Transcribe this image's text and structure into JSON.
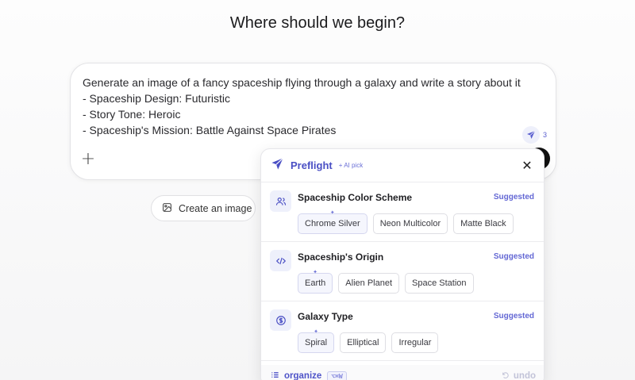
{
  "heading": "Where should we begin?",
  "composer": {
    "prompt_lines": [
      "Generate an image of a fancy spaceship flying through a galaxy and write a story about it",
      "- Spaceship Design: Futuristic",
      "- Story Tone: Heroic",
      "- Spaceship's Mission: Battle Against Space Pirates"
    ],
    "plus_glyph": "+",
    "preflight_count": "3"
  },
  "create_image_chip": "Create an image",
  "preflight": {
    "title": "Preflight",
    "ai_pick": "+ AI pick",
    "close_glyph": "✕",
    "sections": [
      {
        "title": "Spaceship Color Scheme",
        "tag": "Suggested",
        "icon": "users-icon",
        "options": [
          "Chrome Silver",
          "Neon Multicolor",
          "Matte Black"
        ],
        "picked": 0
      },
      {
        "title": "Spaceship's Origin",
        "tag": "Suggested",
        "icon": "code-icon",
        "options": [
          "Earth",
          "Alien Planet",
          "Space Station"
        ],
        "picked": 0
      },
      {
        "title": "Galaxy Type",
        "tag": "Suggested",
        "icon": "dollar-circle-icon",
        "options": [
          "Spiral",
          "Elliptical",
          "Irregular"
        ],
        "picked": 0
      }
    ],
    "footer": {
      "organize": "organize",
      "shortcut": "⌥⌘W",
      "undo": "undo"
    }
  },
  "colors": {
    "accent": "#4a4fc4",
    "accent_light": "#eef0fb"
  }
}
